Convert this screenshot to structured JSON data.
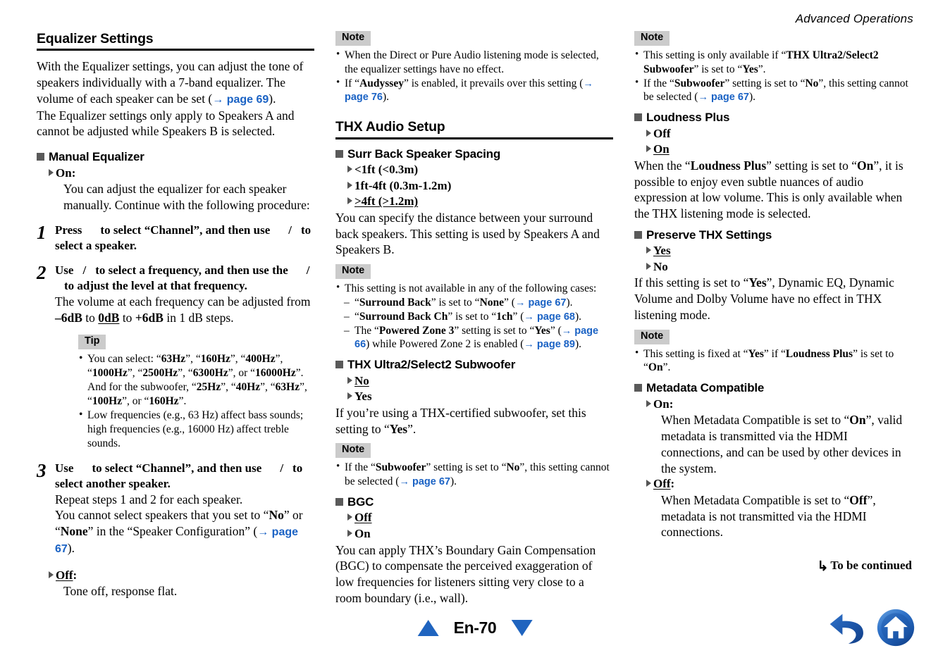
{
  "header": {
    "running_head": "Advanced Operations"
  },
  "colors": {
    "link": "#1a62c4",
    "nav": "#1f64bf",
    "badge_bg": "#cbcbcb",
    "bullet_square": "#5a5a5a"
  },
  "left_column": {
    "section_title": "Equalizer Settings",
    "intro_p1_a": "With the Equalizer settings, you can adjust the tone of speakers individually with a 7-band equalizer. The volume of each speaker can be set (",
    "intro_p1_link": "→ page 69",
    "intro_p1_b": ").",
    "intro_p2": "The Equalizer settings only apply to Speakers A and cannot be adjusted while Speakers B is selected.",
    "manual_eq": {
      "heading": "Manual Equalizer",
      "on_label": "On",
      "on_colon": ":",
      "on_desc": "You can adjust the equalizer for each speaker manually. Continue with the following procedure:",
      "off_label": "Off",
      "off_colon": ":",
      "off_desc": "Tone off, response flat."
    },
    "steps": [
      {
        "num": "1",
        "title_a": "Press",
        "title_b": "to select “Channel”, and then use",
        "title_c": "/",
        "title_d": "to select a speaker."
      },
      {
        "num": "2",
        "title_a": "Use",
        "title_b": "/",
        "title_c": "to select a frequency, and then use the",
        "title_d": "/",
        "title_e": "to adjust the level at that frequency.",
        "body_a": "The volume at each frequency can be adjusted from ",
        "body_b": "–6dB",
        "body_c": " to ",
        "body_d": "0dB",
        "body_e": " to ",
        "body_f": "+6dB",
        "body_g": " in 1 dB steps."
      },
      {
        "num": "3",
        "title_a": "Use",
        "title_b": "to select “Channel”, and then use",
        "title_c": "/",
        "title_d": "to select another speaker.",
        "body1": "Repeat steps 1 and 2 for each speaker.",
        "body2_a": "You cannot select speakers that you set to “",
        "body2_b": "No",
        "body2_c": "” or “",
        "body2_d": "None",
        "body2_e": "” in the “Speaker Configuration” (",
        "body2_link": "→ page 67",
        "body2_f": ")."
      }
    ],
    "tip": {
      "badge": "Tip",
      "items": [
        {
          "a": "You can select: “",
          "b": "63Hz",
          "c": "”, “",
          "d": "160Hz",
          "e": "”, “",
          "f": "400Hz",
          "g": "”, “",
          "h": "1000Hz",
          "i": "”, “",
          "j": "2500Hz",
          "k": "”, “",
          "l": "6300Hz",
          "m": "”, or “",
          "n": "16000Hz",
          "o": "”. And for the subwoofer, “",
          "p": "25Hz",
          "q": "”, “",
          "r": "40Hz",
          "s": "”, “",
          "t": "63Hz",
          "u": "”, “",
          "v": "100Hz",
          "w": "”, or “",
          "x": "160Hz",
          "y": "”."
        },
        {
          "text": "Low frequencies (e.g., 63 Hz) affect bass sounds; high frequencies (e.g., 16000 Hz) affect treble sounds."
        }
      ]
    }
  },
  "mid_column": {
    "note1": {
      "badge": "Note",
      "item1": "When the Direct or Pure Audio listening mode is selected, the equalizer settings have no effect.",
      "item2_a": "If “",
      "item2_b": "Audyssey",
      "item2_c": "” is enabled, it prevails over this setting (",
      "item2_link": "→ page 76",
      "item2_d": ")."
    },
    "section_title": "THX Audio Setup",
    "surr_back": {
      "heading": "Surr Back Speaker Spacing",
      "options": [
        {
          "label": "<1ft (<0.3m)",
          "default": false
        },
        {
          "label": "1ft-4ft (0.3m-1.2m)",
          "default": false
        },
        {
          "label": ">4ft (>1.2m)",
          "default": true
        }
      ],
      "desc": "You can specify the distance between your surround back speakers. This setting is used by Speakers A and Speakers B."
    },
    "note2": {
      "badge": "Note",
      "lead": "This setting is not available in any of the following cases:",
      "sub": [
        {
          "a": "“",
          "b": "Surround Back",
          "c": "” is set to “",
          "d": "None",
          "e": "” (",
          "link": "→ page 67",
          "f": ")."
        },
        {
          "a": "“",
          "b": "Surround Back Ch",
          "c": "” is set to “",
          "d": "1ch",
          "e": "” (",
          "link": "→ page 68",
          "f": ")."
        },
        {
          "a": "The “",
          "b": "Powered Zone 3",
          "c": "” setting is set to “",
          "d": "Yes",
          "e": "” (",
          "link": "→ page 66",
          "f": ") while Powered Zone 2 is enabled (",
          "link2": "→ page 89",
          "g": ")."
        }
      ]
    },
    "thx_sub": {
      "heading": "THX Ultra2/Select2 Subwoofer",
      "options": [
        {
          "label": "No",
          "default": true
        },
        {
          "label": "Yes",
          "default": false
        }
      ],
      "desc_a": "If you’re using a THX-certified subwoofer, set this setting to “",
      "desc_b": "Yes",
      "desc_c": "”."
    },
    "note3": {
      "badge": "Note",
      "item_a": "If the “",
      "item_b": "Subwoofer",
      "item_c": "” setting is set to “",
      "item_d": "No",
      "item_e": "”, this setting cannot be selected (",
      "item_link": "→ page 67",
      "item_f": ")."
    },
    "bgc": {
      "heading": "BGC",
      "options": [
        {
          "label": "Off",
          "default": true
        },
        {
          "label": "On",
          "default": false
        }
      ],
      "desc": "You can apply THX’s Boundary Gain Compensation (BGC) to compensate the perceived exaggeration of low frequencies for listeners sitting very close to a room boundary (i.e., wall)."
    }
  },
  "right_column": {
    "note1": {
      "badge": "Note",
      "item1_a": "This setting is only available if “",
      "item1_b": "THX Ultra2/Select2 Subwoofer",
      "item1_c": "” is set to “",
      "item1_d": "Yes",
      "item1_e": "”.",
      "item2_a": "If the “",
      "item2_b": "Subwoofer",
      "item2_c": "” setting is set to “",
      "item2_d": "No",
      "item2_e": "”, this setting cannot be selected (",
      "item2_link": "→ page 67",
      "item2_f": ")."
    },
    "loudness": {
      "heading": "Loudness Plus",
      "options": [
        {
          "label": "Off",
          "default": false
        },
        {
          "label": "On",
          "default": true
        }
      ],
      "desc_a": "When the “",
      "desc_b": "Loudness Plus",
      "desc_c": "” setting is set to “",
      "desc_d": "On",
      "desc_e": "”, it is possible to enjoy even subtle nuances of audio expression at low volume. This is only available when the THX listening mode is selected."
    },
    "preserve": {
      "heading": "Preserve THX Settings",
      "options": [
        {
          "label": "Yes",
          "default": true
        },
        {
          "label": "No",
          "default": false
        }
      ],
      "desc_a": "If this setting is set to “",
      "desc_b": "Yes",
      "desc_c": "”, Dynamic EQ, Dynamic Volume and Dolby Volume have no effect in THX listening mode."
    },
    "note2": {
      "badge": "Note",
      "item_a": "This setting is fixed at “",
      "item_b": "Yes",
      "item_c": "” if “",
      "item_d": "Loudness Plus",
      "item_e": "” is set to “",
      "item_f": "On",
      "item_g": "”."
    },
    "metadata": {
      "heading": "Metadata Compatible",
      "on_label": "On",
      "on_colon": ":",
      "on_desc_a": "When Metadata Compatible is set to “",
      "on_desc_b": "On",
      "on_desc_c": "”, valid metadata is transmitted via the HDMI connections, and can be used by other devices in the system.",
      "off_label": "Off",
      "off_colon": ":",
      "off_desc_a": "When Metadata Compatible is set to “",
      "off_desc_b": "Off",
      "off_desc_c": "”, metadata is not transmitted via the HDMI connections."
    },
    "to_be_continued": "To be continued"
  },
  "footer": {
    "page_label": "En-70",
    "prev_icon": "triangle-up-icon",
    "next_icon": "triangle-down-icon",
    "back_icon": "back-arrow-icon",
    "home_icon": "home-icon"
  }
}
